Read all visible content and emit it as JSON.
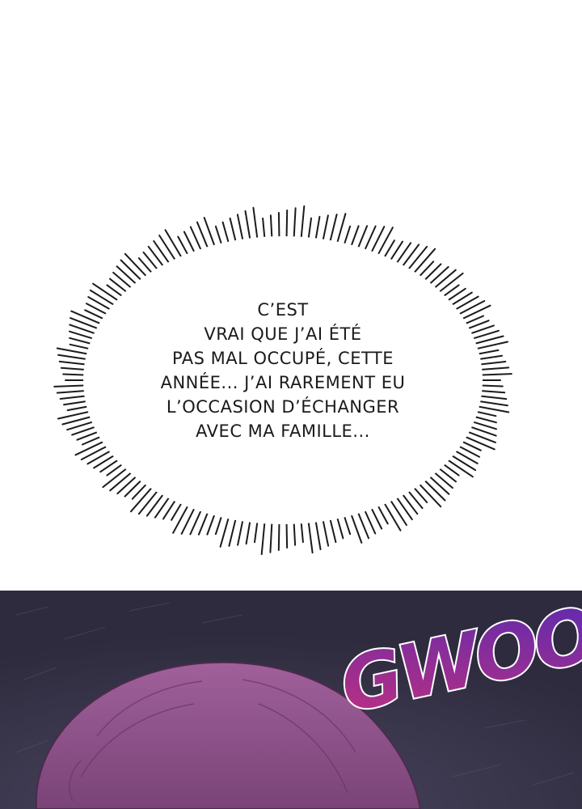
{
  "bubble": {
    "lines": [
      "C’EST",
      "VRAI QUE J’AI ÉTÉ",
      "PAS MAL OCCUPÉ, CETTE",
      "ANNÉE... J’AI RAREMENT EU",
      "L’OCCASION D’ÉCHANGER",
      "AVEC MA FAMILLE..."
    ]
  },
  "panel": {
    "sfx": "GWOO",
    "colors": {
      "background": "#37334a",
      "hair": "#8a4f86",
      "sfx_fill": "#b0287e",
      "sfx_fill_end": "#5a2bb0",
      "sfx_outline": "#ffffff"
    }
  }
}
